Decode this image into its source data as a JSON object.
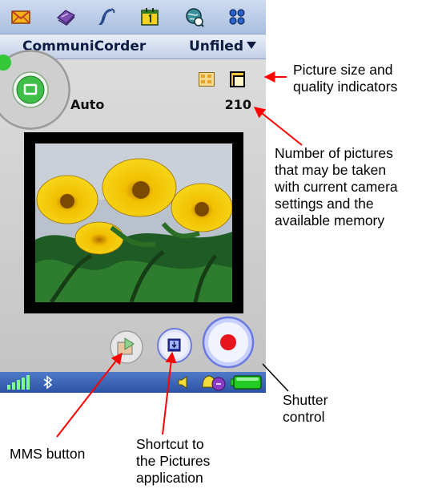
{
  "launcher": {
    "icons": [
      "mail-icon",
      "contacts-icon",
      "phone-icon",
      "calendar-icon",
      "internet-icon",
      "applications-icon"
    ]
  },
  "title_bar": {
    "app_title": "CommuniCorder",
    "category": "Unfiled"
  },
  "camera": {
    "mode": "Auto",
    "pictures_remaining": "210"
  },
  "colors": {
    "shutter": "#e8141e",
    "battery": "#22cc22",
    "status_bar": "#3a62b4",
    "annotation_arrow": "#ff0000"
  },
  "annotations": {
    "size_quality": [
      "Picture size and",
      "quality indicators"
    ],
    "picture_count": [
      "Number of pictures",
      "that may be taken",
      "with current camera",
      "settings and the",
      "available memory"
    ],
    "shutter": [
      "Shutter",
      "control"
    ],
    "mms": [
      "MMS button"
    ],
    "pictures_shortcut": [
      "Shortcut to",
      "the Pictures",
      "application"
    ]
  }
}
